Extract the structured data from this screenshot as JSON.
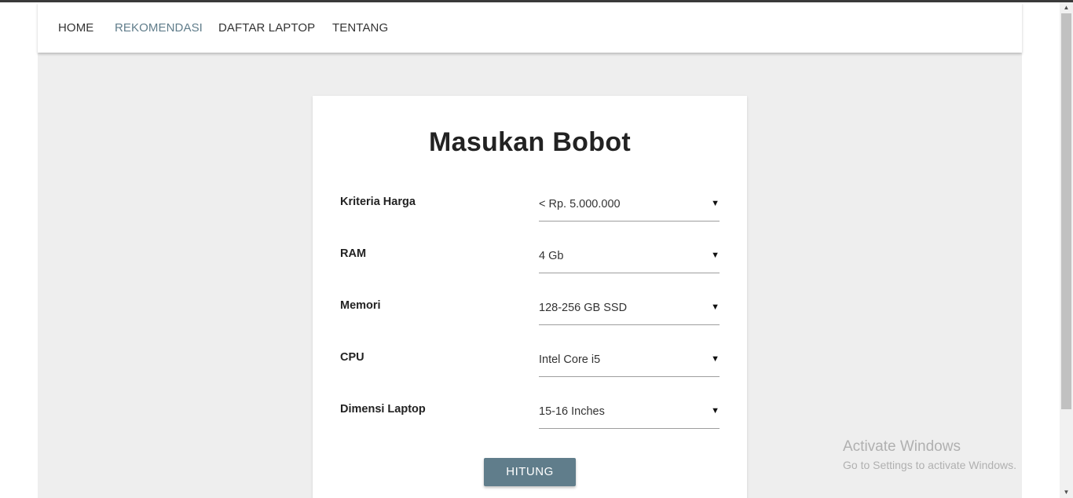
{
  "nav": {
    "items": [
      {
        "label": "HOME"
      },
      {
        "label": "REKOMENDASI"
      },
      {
        "label": "DAFTAR LAPTOP"
      },
      {
        "label": "TENTANG"
      }
    ]
  },
  "form": {
    "title": "Masukan Bobot",
    "fields": [
      {
        "label": "Kriteria Harga",
        "value": "< Rp. 5.000.000"
      },
      {
        "label": "RAM",
        "value": "4 Gb"
      },
      {
        "label": "Memori",
        "value": "128-256 GB SSD"
      },
      {
        "label": "CPU",
        "value": "Intel Core i5"
      },
      {
        "label": "Dimensi Laptop",
        "value": "15-16 Inches"
      }
    ],
    "dropdown_arrow": "▼",
    "submit_label": "HITUNG"
  },
  "scrollbar": {
    "up_arrow": "▲",
    "down_arrow": "▼"
  },
  "watermark": {
    "title": "Activate Windows",
    "subtitle": "Go to Settings to activate Windows."
  },
  "colors": {
    "accent": "#607d8b",
    "background": "#eeeeee",
    "card": "#ffffff"
  }
}
